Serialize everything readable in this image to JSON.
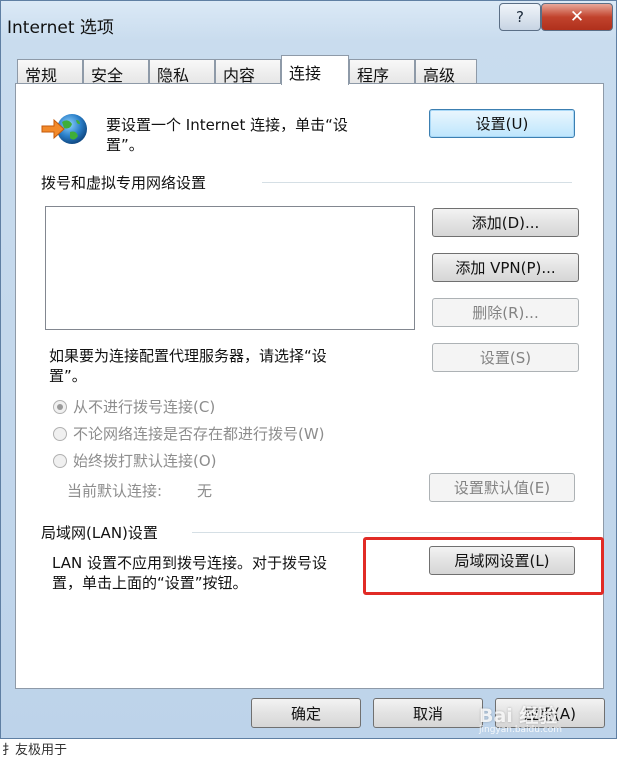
{
  "window": {
    "title": "Internet 选项",
    "help_label": "?",
    "close_label": "✕"
  },
  "tabs": [
    {
      "label": "常规",
      "active": false
    },
    {
      "label": "安全",
      "active": false
    },
    {
      "label": "隐私",
      "active": false
    },
    {
      "label": "内容",
      "active": false
    },
    {
      "label": "连接",
      "active": true
    },
    {
      "label": "程序",
      "active": false
    },
    {
      "label": "高级",
      "active": false
    }
  ],
  "setup": {
    "icon": "internet-connect-icon",
    "text_line1": "要设置一个 Internet 连接，单击“设",
    "text_line2": "置”。",
    "button": "设置(U)"
  },
  "dialup": {
    "group_title": "拨号和虚拟专用网络设置",
    "add_button": "添加(D)...",
    "add_vpn_button": "添加 VPN(P)...",
    "remove_button": "删除(R)...",
    "proxy_text_line1": "如果要为连接配置代理服务器，请选择“设",
    "proxy_text_line2": "置”。",
    "settings_button": "设置(S)",
    "radios": [
      {
        "label": "从不进行拨号连接(C)",
        "selected": true
      },
      {
        "label": "不论网络连接是否存在都进行拨号(W)",
        "selected": false
      },
      {
        "label": "始终拨打默认连接(O)",
        "selected": false
      }
    ],
    "default_label": "当前默认连接:",
    "default_value": "无",
    "set_default_button": "设置默认值(E)"
  },
  "lan": {
    "group_title": "局域网(LAN)设置",
    "text_line1": "LAN 设置不应用到拨号连接。对于拨号设",
    "text_line2": "置，单击上面的“设置”按钮。",
    "button": "局域网设置(L)"
  },
  "footer": {
    "ok": "确定",
    "cancel": "取消",
    "apply": "应用(A)"
  },
  "overlay": {
    "watermark": "Bai 经验",
    "watermark_sub": "jingyan.baidu.com",
    "below_text": "扌友极用于"
  },
  "colors": {
    "highlight": "#e12b26"
  }
}
